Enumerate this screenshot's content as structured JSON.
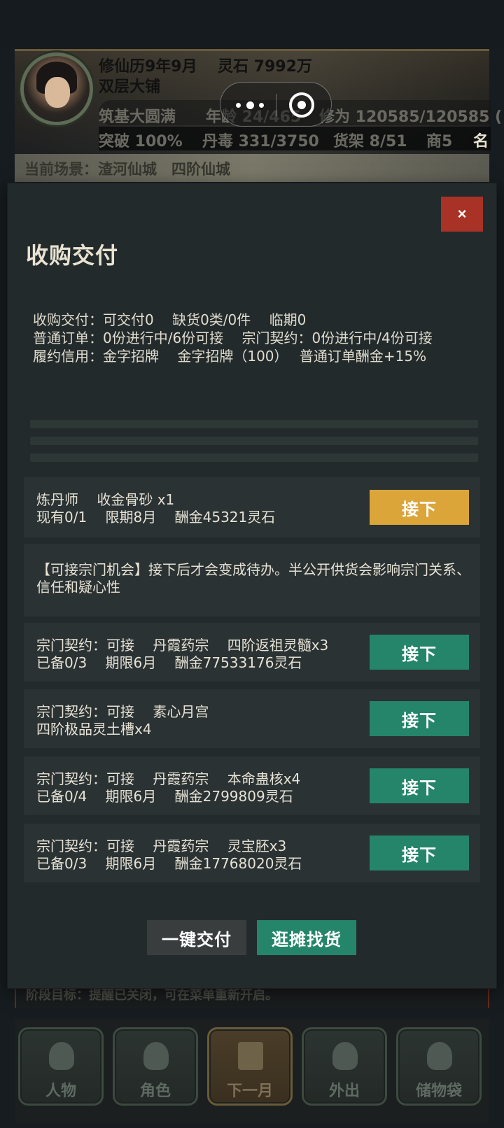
{
  "header": {
    "calendar": "修仙历9年9月",
    "spirit_stones": "灵石 7992万",
    "shop_type": "双层大铺",
    "realm": "筑基大圆满",
    "age": "年龄 24/465",
    "cultivation": "修为 120585/120585 (",
    "breakthrough": "突破 100%",
    "pill_toxicity": "丹毒 331/3750",
    "shelves": "货架 8/51",
    "merchant": "商5",
    "fame": "名",
    "scene": "当前场景：渣河仙城　四阶仙城"
  },
  "modal": {
    "title": "收购交付",
    "close_label": "×",
    "summary": [
      "收购交付：可交付0　 缺货0类/0件　 临期0",
      "普通订单：0份进行中/6份可接　 宗门契约：0份进行中/4份可接",
      "履约信用：金字招牌　 金字招牌（100）　 普通订单酬金+15%"
    ],
    "orders": [
      {
        "line1": "炼丹师　 收金骨砂 x1",
        "line2": "现有0/1　 限期8月　 酬金45321灵石",
        "action": "接下",
        "style": "gold"
      }
    ],
    "notice": "【可接宗门机会】接下后才会变成待办。半公开供货会影响宗门关系、信任和疑心性",
    "contracts": [
      {
        "line1": "宗门契约：可接　 丹霞药宗　 四阶返祖灵髓x3",
        "line2": "已备0/3　 期限6月　 酬金77533176灵石",
        "action": "接下"
      },
      {
        "line1": "宗门契约：可接　 素心月宫",
        "line2": "四阶极品灵土槽x4",
        "action": "接下"
      },
      {
        "line1": "宗门契约：可接　 丹霞药宗　 本命蛊核x4",
        "line2": "已备0/4　 期限6月　 酬金2799809灵石",
        "action": "接下"
      },
      {
        "line1": "宗门契约：可接　 丹霞药宗　 灵宝胚x3",
        "line2": "已备0/3　 期限6月　 酬金17768020灵石",
        "action": "接下"
      }
    ],
    "deliver_all_label": "一键交付",
    "browse_label": "逛摊找货"
  },
  "stage_goal": "阶段目标：提醒已关闭，可在菜单重新开启。",
  "nav": [
    {
      "label": "人物",
      "icon": "person-icon"
    },
    {
      "label": "角色",
      "icon": "role-icon"
    },
    {
      "label": "下一月",
      "icon": "flag-icon"
    },
    {
      "label": "外出",
      "icon": "travel-icon"
    },
    {
      "label": "储物袋",
      "icon": "bag-icon"
    }
  ],
  "colors": {
    "modal_bg": "#232a2b",
    "card_bg": "#2b3233",
    "accept_gold": "#dca53a",
    "accept_green": "#25856a",
    "close_red": "#a93226"
  }
}
